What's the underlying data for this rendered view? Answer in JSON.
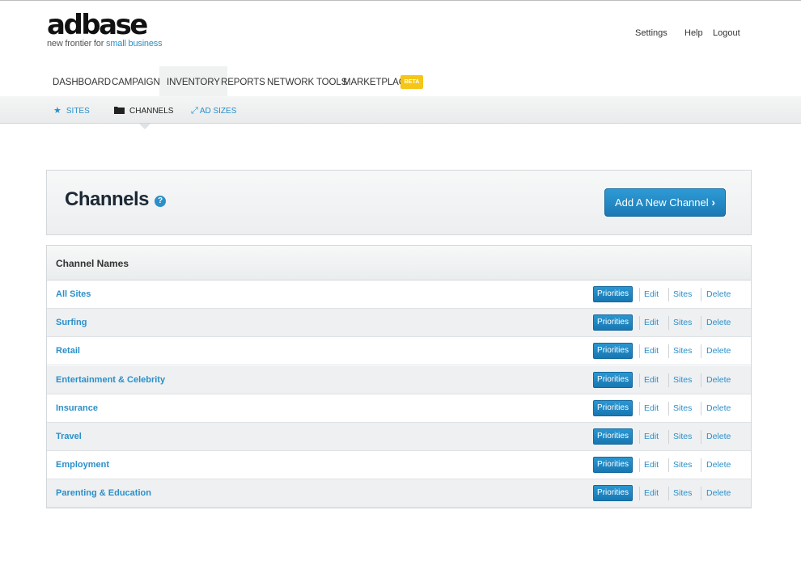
{
  "logo": {
    "wordmark": "adbase",
    "tagline_prefix": "new frontier for ",
    "tagline_highlight": "small business"
  },
  "toplinks": {
    "settings": "Settings",
    "help": "Help",
    "logout": "Logout"
  },
  "mainnav": [
    {
      "label": "DASHBOARD"
    },
    {
      "label": "CAMPAIGNS"
    },
    {
      "label": "INVENTORY",
      "active": true
    },
    {
      "label": "REPORTS"
    },
    {
      "label": "NETWORK TOOLS"
    },
    {
      "label": "MARKETPLACE"
    }
  ],
  "beta_badge": "BETA",
  "subnav": [
    {
      "label": "SITES",
      "icon": "star-icon"
    },
    {
      "label": "CHANNELS",
      "icon": "folder-icon",
      "active": true
    },
    {
      "label": "AD SIZES",
      "icon": "resize-icon"
    }
  ],
  "page": {
    "title": "Channels",
    "help_icon": "?",
    "add_button": "Add A New Channel",
    "add_button_icon": "›"
  },
  "table": {
    "header": "Channel Names",
    "actions": {
      "priorities": "Priorities",
      "edit": "Edit",
      "sites": "Sites",
      "delete": "Delete"
    },
    "rows": [
      {
        "name": "All Sites"
      },
      {
        "name": "Surfing"
      },
      {
        "name": "Retail"
      },
      {
        "name": "Entertainment & Celebrity"
      },
      {
        "name": "Insurance"
      },
      {
        "name": "Travel"
      },
      {
        "name": "Employment"
      },
      {
        "name": "Parenting & Education"
      }
    ]
  },
  "colors": {
    "accent": "#2b8fc8",
    "beta": "#f5c518",
    "title": "#1c2935"
  }
}
